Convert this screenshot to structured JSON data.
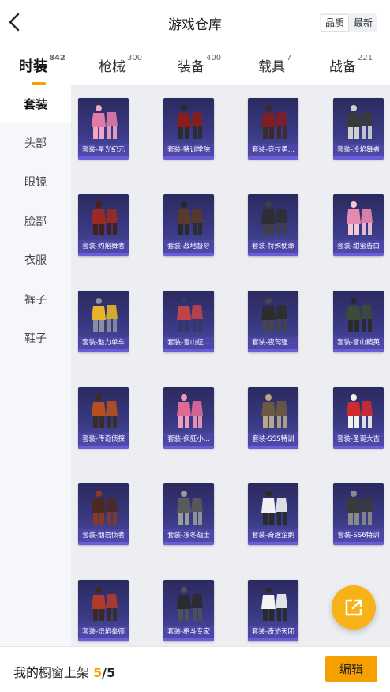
{
  "header": {
    "title": "游戏仓库",
    "sort": [
      "品质",
      "最新"
    ]
  },
  "tabs": [
    {
      "label": "时装",
      "count": "842"
    },
    {
      "label": "枪械",
      "count": "300"
    },
    {
      "label": "装备",
      "count": "400"
    },
    {
      "label": "载具",
      "count": "7"
    },
    {
      "label": "战备",
      "count": "221"
    }
  ],
  "sidebar": [
    "套装",
    "头部",
    "眼镜",
    "脸部",
    "衣服",
    "裤子",
    "鞋子"
  ],
  "items": [
    {
      "label": "套装-星光纪元"
    },
    {
      "label": "套装-特训学院"
    },
    {
      "label": "套装-竞技勇..."
    },
    {
      "label": "套装-冷焰舞者"
    },
    {
      "label": "套装-灼焰舞者"
    },
    {
      "label": "套装-战地督导"
    },
    {
      "label": "套装-特殊使命"
    },
    {
      "label": "套装-甜蜜告白"
    },
    {
      "label": "套装-魅力单车"
    },
    {
      "label": "套装-雪山征..."
    },
    {
      "label": "套装-夜莺强..."
    },
    {
      "label": "套装-雪山精英"
    },
    {
      "label": "套装-传奇侦探"
    },
    {
      "label": "套装-疯狂小..."
    },
    {
      "label": "套装-SSS特训"
    },
    {
      "label": "套装-圣诞大吉"
    },
    {
      "label": "套装-烟岩侦者"
    },
    {
      "label": "套装-凛冬战士"
    },
    {
      "label": "套装-奇趣企鹅"
    },
    {
      "label": "套装-SS6特训"
    },
    {
      "label": "套装-炽焰拳师"
    },
    {
      "label": "套装-格斗专家"
    },
    {
      "label": "套装-奇迹天团"
    }
  ],
  "bottom": {
    "text": "我的橱窗上架 ",
    "current": "5",
    "total": "/5",
    "edit": "编辑"
  },
  "colors": {
    "accent": "#f5a000",
    "card": "#3a3a86",
    "fab": "#f7b21a"
  }
}
